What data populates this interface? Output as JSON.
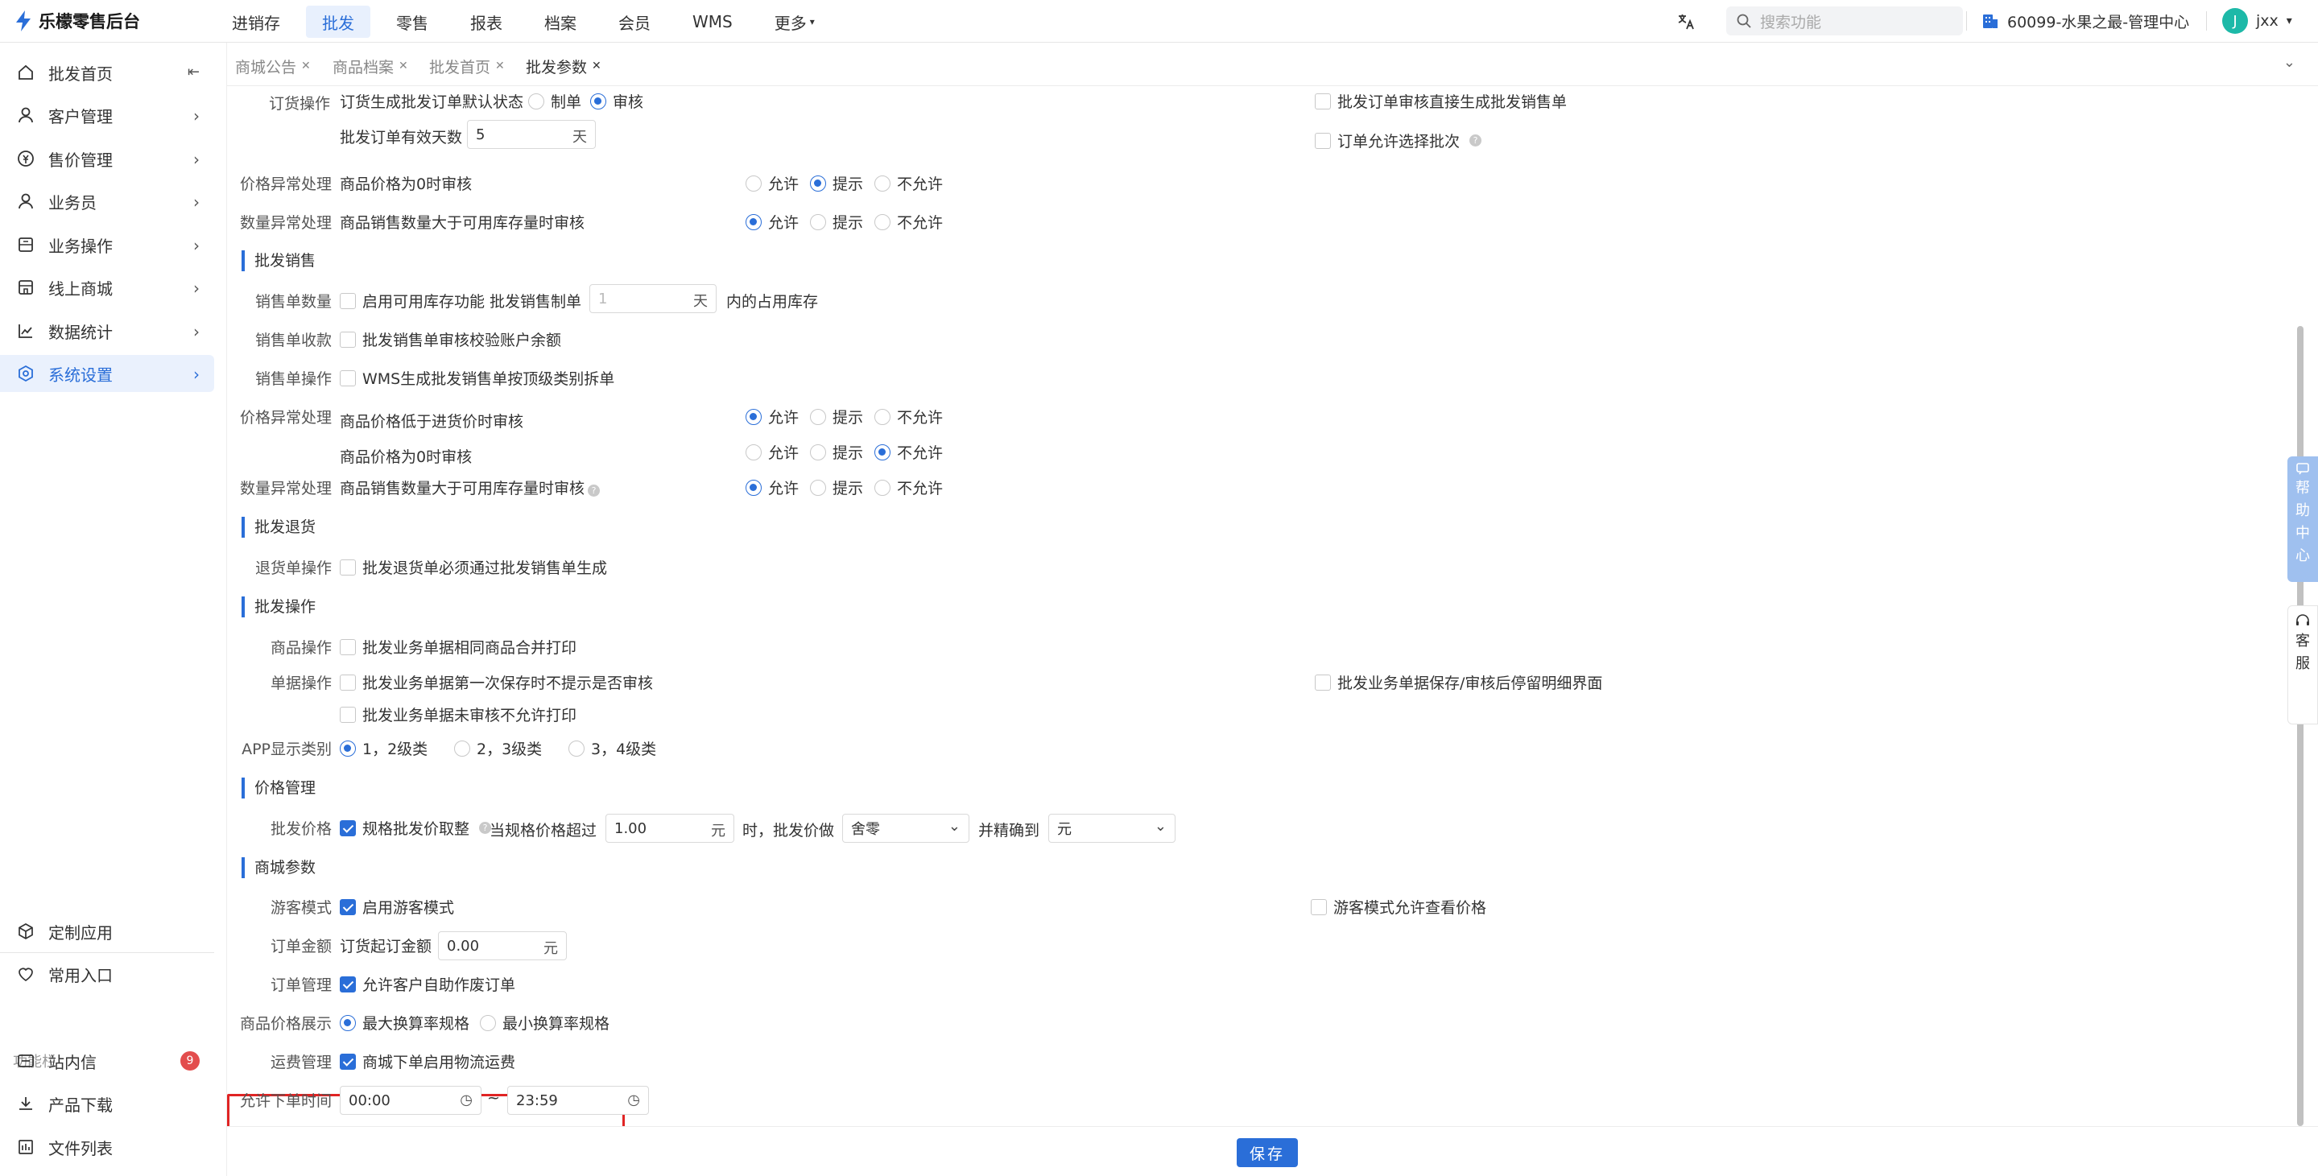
{
  "app": {
    "title": "乐檬零售后台"
  },
  "topnav": {
    "items": [
      "进销存",
      "批发",
      "零售",
      "报表",
      "档案",
      "会员",
      "WMS",
      "更多"
    ],
    "active_index": 1
  },
  "header": {
    "search_placeholder": "搜索功能",
    "org": "60099-水果之最-管理中心",
    "user": "jxx",
    "user_initial": "J"
  },
  "sidebar": {
    "items": [
      "批发首页",
      "客户管理",
      "售价管理",
      "业务员",
      "业务操作",
      "线上商城",
      "数据统计",
      "系统设置"
    ],
    "active_index": 7,
    "bottom_items": [
      "定制应用",
      "常用入口"
    ],
    "group_label": "功能栏",
    "func_items": [
      "站内信",
      "产品下载",
      "文件列表"
    ],
    "message_count": "9"
  },
  "tabs": [
    {
      "label": "商城公告"
    },
    {
      "label": "商品档案"
    },
    {
      "label": "批发首页"
    },
    {
      "label": "批发参数",
      "active": true
    }
  ],
  "form": {
    "order_op": {
      "label": "订货操作",
      "default_status_label": "订货生成批发订单默认状态",
      "opt_draft": "制单",
      "opt_audit": "审核",
      "validity_label": "批发订单有效天数",
      "validity_value": "5",
      "days_unit": "天",
      "cb_direct": "批发订单审核直接生成批发销售单",
      "cb_batch": "订单允许选择批次"
    },
    "price_exc1": {
      "label": "价格异常处理",
      "text": "商品价格为0时审核",
      "selected": "提示"
    },
    "qty_exc1": {
      "label": "数量异常处理",
      "text": "商品销售数量大于可用库存量时审核",
      "selected": "允许"
    },
    "radio_opts": [
      "允许",
      "提示",
      "不允许"
    ],
    "sec_sales": "批发销售",
    "sales_qty": {
      "label": "销售单数量",
      "cb": "启用可用库存功能",
      "draft_label": "批发销售制单",
      "draft_value": "1",
      "days_unit": "天",
      "suffix": "内的占用库存"
    },
    "sales_collect": {
      "label": "销售单收款",
      "cb": "批发销售单审核校验账户余额"
    },
    "sales_op": {
      "label": "销售单操作",
      "cb": "WMS生成批发销售单按顶级类别拆单"
    },
    "price_exc2": {
      "label": "价格异常处理",
      "text1": "商品价格低于进货价时审核",
      "selected1": "允许",
      "text2": "商品价格为0时审核",
      "selected2": "不允许"
    },
    "qty_exc2": {
      "label": "数量异常处理",
      "text": "商品销售数量大于可用库存量时审核",
      "selected": "允许"
    },
    "sec_return": "批发退货",
    "return_op": {
      "label": "退货单操作",
      "cb": "批发退货单必须通过批发销售单生成"
    },
    "sec_ops": "批发操作",
    "goods_op": {
      "label": "商品操作",
      "cb": "批发业务单据相同商品合并打印"
    },
    "doc_op": {
      "label": "单据操作",
      "cb1": "批发业务单据第一次保存时不提示是否审核",
      "cb2": "批发业务单据未审核不允许打印",
      "cb3": "批发业务单据保存/审核后停留明细界面"
    },
    "app_cat": {
      "label": "APP显示类别",
      "opts": [
        "1，2级类",
        "2，3级类",
        "3，4级类"
      ],
      "selected": "1，2级类"
    },
    "sec_price": "价格管理",
    "wholesale_price": {
      "label": "批发价格",
      "cb": "规格批发价取整",
      "exceed_label": "当规格价格超过",
      "exceed_value": "1.00",
      "yuan": "元",
      "when": "时，批发价做",
      "mode": "舍零",
      "precise": "并精确到",
      "unit": "元"
    },
    "sec_mall": "商城参数",
    "guest": {
      "label": "游客模式",
      "cb": "启用游客模式",
      "cb2": "游客模式允许查看价格"
    },
    "order_amt": {
      "label": "订单金额",
      "text": "订货起订金额",
      "value": "0.00",
      "yuan": "元"
    },
    "order_mgmt": {
      "label": "订单管理",
      "cb": "允许客户自助作废订单"
    },
    "price_display": {
      "label": "商品价格展示",
      "opt_max": "最大换算率规格",
      "opt_min": "最小换算率规格",
      "selected": "最大换算率规格"
    },
    "freight": {
      "label": "运费管理",
      "cb": "商城下单启用物流运费"
    },
    "order_time": {
      "label": "允许下单时间",
      "start": "00:00",
      "end": "23:59",
      "sep": "~"
    }
  },
  "footer": {
    "save": "保存"
  },
  "float": {
    "help": [
      "帮",
      "助",
      "中",
      "心"
    ],
    "service": [
      "客",
      "服"
    ]
  },
  "colors": {
    "accent": "#2a6ed8",
    "highlight": "#e02424",
    "badge": "#e34d4d"
  }
}
